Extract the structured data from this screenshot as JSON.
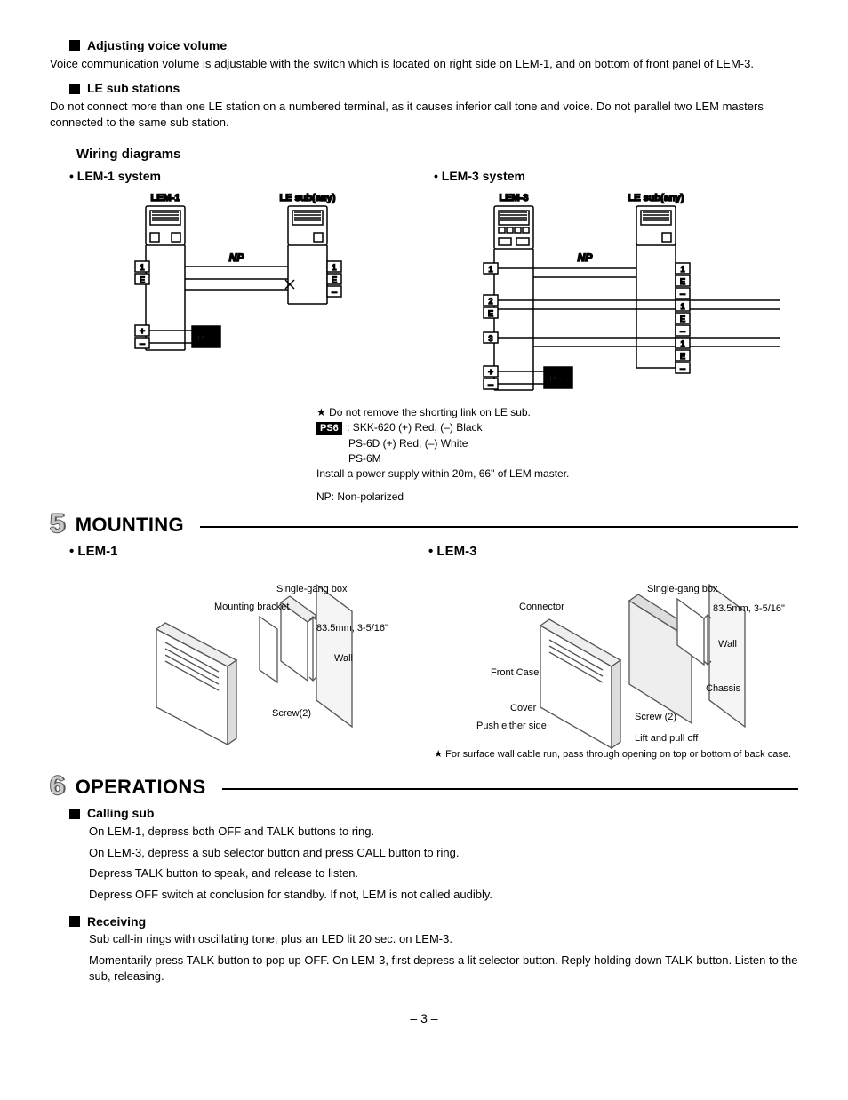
{
  "sections": {
    "adjusting": {
      "heading": "Adjusting voice volume",
      "body": "Voice communication volume is adjustable with the switch which is located on right side on LEM-1, and on bottom of front panel of LEM-3."
    },
    "le_sub": {
      "heading": "LE sub stations",
      "body": "Do not connect more than one LE station on a numbered terminal, as it causes inferior call tone and voice. Do not parallel two LEM masters connected to the same sub station."
    },
    "wiring": {
      "heading": "Wiring diagrams",
      "lem1_title": "• LEM-1 system",
      "lem3_title": "• LEM-3 system",
      "labels": {
        "lem1": "LEM-1",
        "lem3": "LEM-3",
        "le_sub_any": "LE sub(any)",
        "np": "NP",
        "ps6": "PS6",
        "term1": "1",
        "term2": "2",
        "term3": "3",
        "termE": "E",
        "plus": "+",
        "minus": "–"
      },
      "notes": {
        "star1": "★ Do not remove the shorting link on LE sub.",
        "ps6_line": ": SKK-620 (+) Red, (–) Black",
        "ps6d": "PS-6D (+) Red, (–) White",
        "ps6m": "PS-6M",
        "install": "Install a power supply within 20m, 66\" of LEM master.",
        "np_note": "NP: Non-polarized"
      }
    },
    "mounting": {
      "num": "5",
      "title": "MOUNTING",
      "lem1": "•  LEM-1",
      "lem3": "•  LEM-3",
      "labels": {
        "single_gang": "Single-gang box",
        "mounting_bracket": "Mounting bracket",
        "dim": "83.5mm, 3-5/16\"",
        "wall": "Wall",
        "screw2": "Screw(2)",
        "screw_2b": "Screw (2)",
        "connector": "Connector",
        "front_case": "Front Case",
        "cover": "Cover",
        "push_either": "Push either side",
        "chassis": "Chassis",
        "lift_pull": "Lift and pull off"
      },
      "star2": "★  For surface wall cable run, pass through opening on top or bottom of back case."
    },
    "operations": {
      "num": "6",
      "title": "OPERATIONS",
      "calling": {
        "heading": "Calling sub",
        "l1": "On LEM-1, depress both OFF and TALK buttons to ring.",
        "l2": "On LEM-3, depress a sub selector button and press CALL button to ring.",
        "l3": "Depress TALK button to speak, and release to listen.",
        "l4": "Depress OFF switch at conclusion for standby. If not, LEM is not called audibly."
      },
      "receiving": {
        "heading": "Receiving",
        "l1": "Sub call-in rings with oscillating tone, plus an LED lit 20 sec. on LEM-3.",
        "l2": "Momentarily press TALK button to pop up OFF. On LEM-3, first depress a lit selector button. Reply holding down TALK button. Listen to the sub, releasing."
      }
    },
    "page_num": "– 3 –"
  }
}
